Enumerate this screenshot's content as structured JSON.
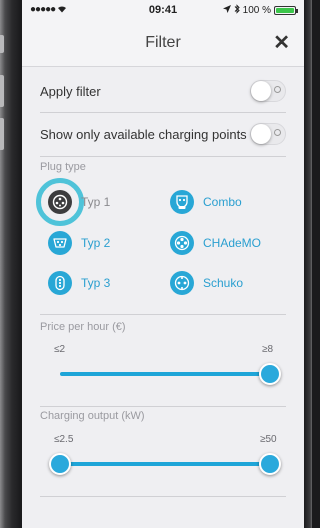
{
  "status_bar": {
    "signal": "●●●●● ",
    "wifi_icon": "wifi-icon",
    "time": "09:41",
    "location_icon": "location-arrow-icon",
    "bluetooth_icon": "bluetooth-icon",
    "battery_text": "100 %",
    "battery_level": 1.0
  },
  "header": {
    "title": "Filter",
    "close_label": "✕"
  },
  "filters": {
    "apply_filter": {
      "label": "Apply filter",
      "on": false
    },
    "only_available": {
      "label": "Show only available charging points",
      "on": false
    }
  },
  "plug_type": {
    "heading": "Plug type",
    "items": [
      {
        "label": "Typ 1",
        "icon": "typ1-plug-icon",
        "selected": true
      },
      {
        "label": "Combo",
        "icon": "combo-plug-icon",
        "selected": false
      },
      {
        "label": "Typ 2",
        "icon": "typ2-plug-icon",
        "selected": false
      },
      {
        "label": "CHAdeMO",
        "icon": "chademo-plug-icon",
        "selected": false
      },
      {
        "label": "Typ 3",
        "icon": "typ3-plug-icon",
        "selected": false
      },
      {
        "label": "Schuko",
        "icon": "schuko-plug-icon",
        "selected": false
      }
    ]
  },
  "price": {
    "heading": "Price per hour (€)",
    "min_label": "≤2",
    "max_label": "≥8",
    "selected_max_fraction": 1.0
  },
  "output": {
    "heading": "Charging output (kW)",
    "min_label": "≤2.5",
    "max_label": "≥50",
    "selected_min_fraction": 0.0,
    "selected_max_fraction": 1.0
  },
  "colors": {
    "accent": "#28a7d6",
    "highlight_ring": "#4fc3d9"
  }
}
